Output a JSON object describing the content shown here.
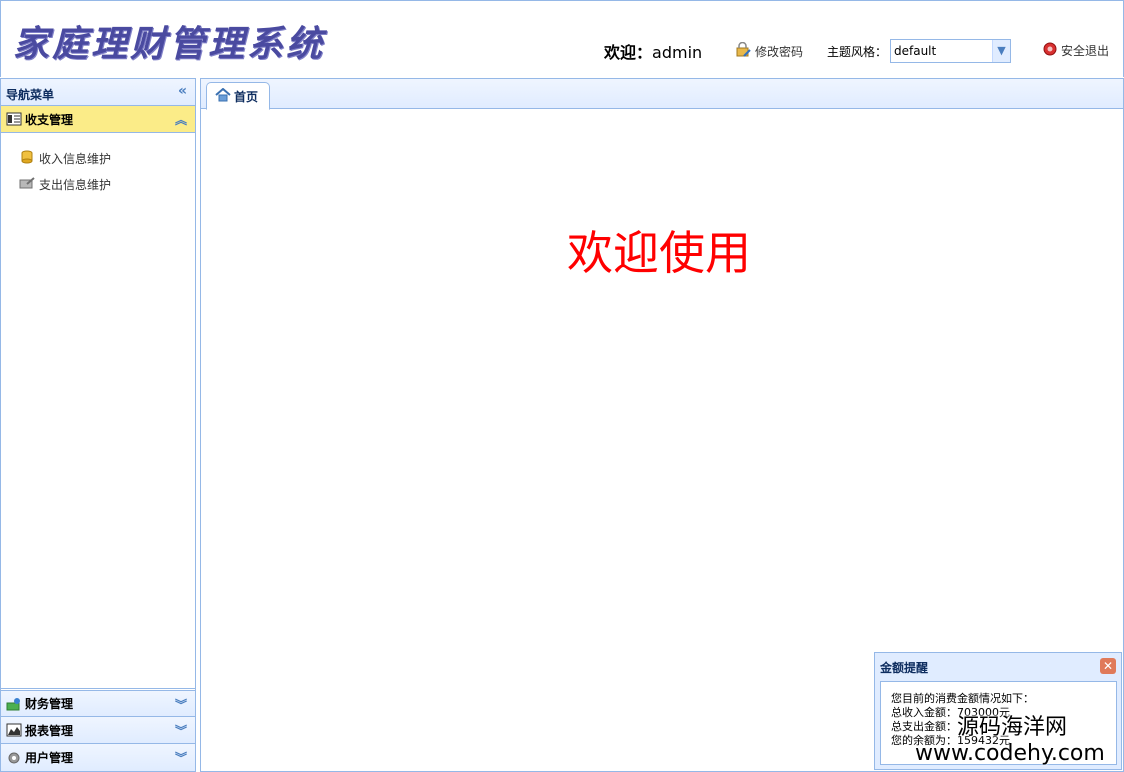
{
  "header": {
    "logo_text": "家庭理财管理系统",
    "welcome_label": "欢迎：",
    "username": "admin",
    "change_password": "修改密码",
    "theme_label": "主题风格：",
    "theme_value": "default",
    "logout": "安全退出"
  },
  "sidebar": {
    "title": "导航菜单",
    "sections": [
      {
        "label": "收支管理",
        "items": [
          "收入信息维护",
          "支出信息维护"
        ]
      },
      {
        "label": "财务管理"
      },
      {
        "label": "报表管理"
      },
      {
        "label": "用户管理"
      }
    ]
  },
  "main": {
    "tab_label": "首页",
    "welcome_text": "欢迎使用"
  },
  "popup": {
    "title": "金额提醒",
    "line1": "您目前的消费金额情况如下：",
    "line2": "总收入金额：703000元",
    "line3": "总支出金额：",
    "line4": "您的余额为：159432元"
  },
  "watermark": {
    "line1": "源码海洋网",
    "line2": "www.codehy.com"
  },
  "colors": {
    "accent": "#95b8e7",
    "active_section": "#fbec88",
    "welcome_red": "#ff0000",
    "logo": "#4a4aa0"
  }
}
